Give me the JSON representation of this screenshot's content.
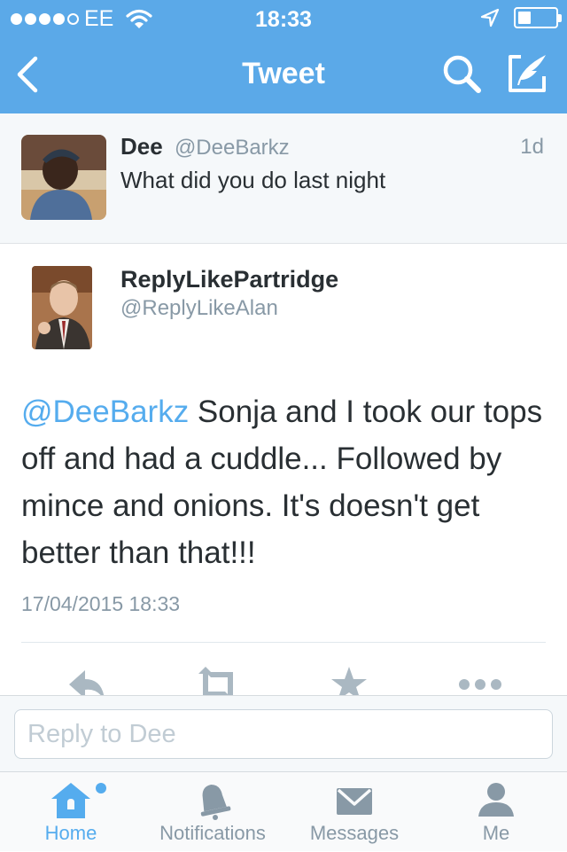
{
  "status_bar": {
    "carrier": "EE",
    "time": "18:33",
    "signal_bars_filled": 4,
    "signal_bars_total": 5,
    "battery_level": 0.35,
    "icons": [
      "wifi-icon",
      "location-arrow-icon",
      "battery-icon"
    ]
  },
  "nav": {
    "title": "Tweet",
    "icons": [
      "back-chevron-icon",
      "search-icon",
      "compose-tweet-icon"
    ]
  },
  "colors": {
    "brand_blue": "#5ba9e8",
    "link_blue": "#55acee",
    "text_dark": "#292f33",
    "text_gray": "#8899a6"
  },
  "parent_tweet": {
    "name": "Dee",
    "handle": "@DeeBarkz",
    "age": "1d",
    "text": "What did you do last night"
  },
  "reply_tweet": {
    "name": "ReplyLikePartridge",
    "handle": "@ReplyLikeAlan",
    "mention": "@DeeBarkz",
    "text": " Sonja and I took our tops off and had a cuddle... Followed by mince and onions. It's doesn't get better than that!!!",
    "timestamp": "17/04/2015 18:33",
    "actions": [
      "reply-icon",
      "retweet-icon",
      "favorite-star-icon",
      "more-dots-icon"
    ]
  },
  "reply_box": {
    "placeholder": "Reply to Dee"
  },
  "tabs": [
    {
      "label": "Home",
      "icon": "home-icon",
      "active": true
    },
    {
      "label": "Notifications",
      "icon": "bell-icon",
      "active": false
    },
    {
      "label": "Messages",
      "icon": "envelope-icon",
      "active": false
    },
    {
      "label": "Me",
      "icon": "person-icon",
      "active": false
    }
  ]
}
